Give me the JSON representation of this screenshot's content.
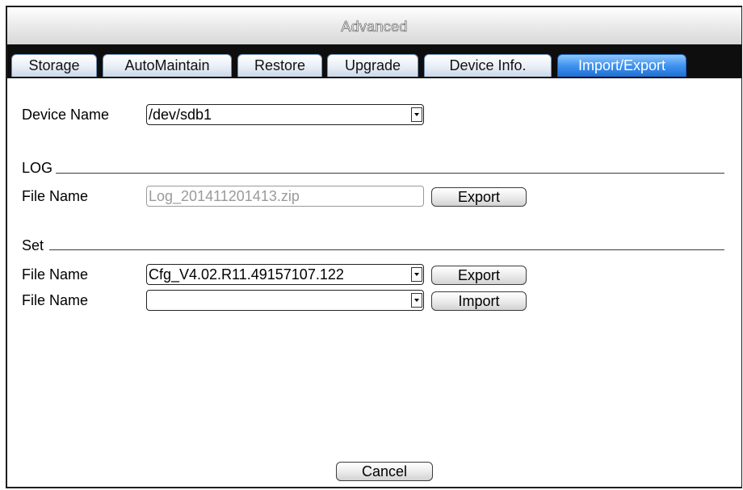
{
  "window": {
    "title": "Advanced"
  },
  "tabs": [
    {
      "label": "Storage"
    },
    {
      "label": "AutoMaintain"
    },
    {
      "label": "Restore"
    },
    {
      "label": "Upgrade"
    },
    {
      "label": "Device Info."
    },
    {
      "label": "Import/Export",
      "active": true
    }
  ],
  "device": {
    "label": "Device Name",
    "value": "/dev/sdb1"
  },
  "log": {
    "section_label": "LOG",
    "file_label": "File Name",
    "file_value": "Log_201411201413.zip",
    "export_label": "Export"
  },
  "set": {
    "section_label": "Set",
    "export_file_label": "File Name",
    "export_file_value": "Cfg_V4.02.R11.49157107.122",
    "export_label": "Export",
    "import_file_label": "File Name",
    "import_file_value": "",
    "import_label": "Import"
  },
  "footer": {
    "cancel_label": "Cancel"
  },
  "colors": {
    "active_tab": "#3f92ef",
    "tab_strip": "#0e0e0e",
    "disabled_text": "#9a9a9a"
  }
}
